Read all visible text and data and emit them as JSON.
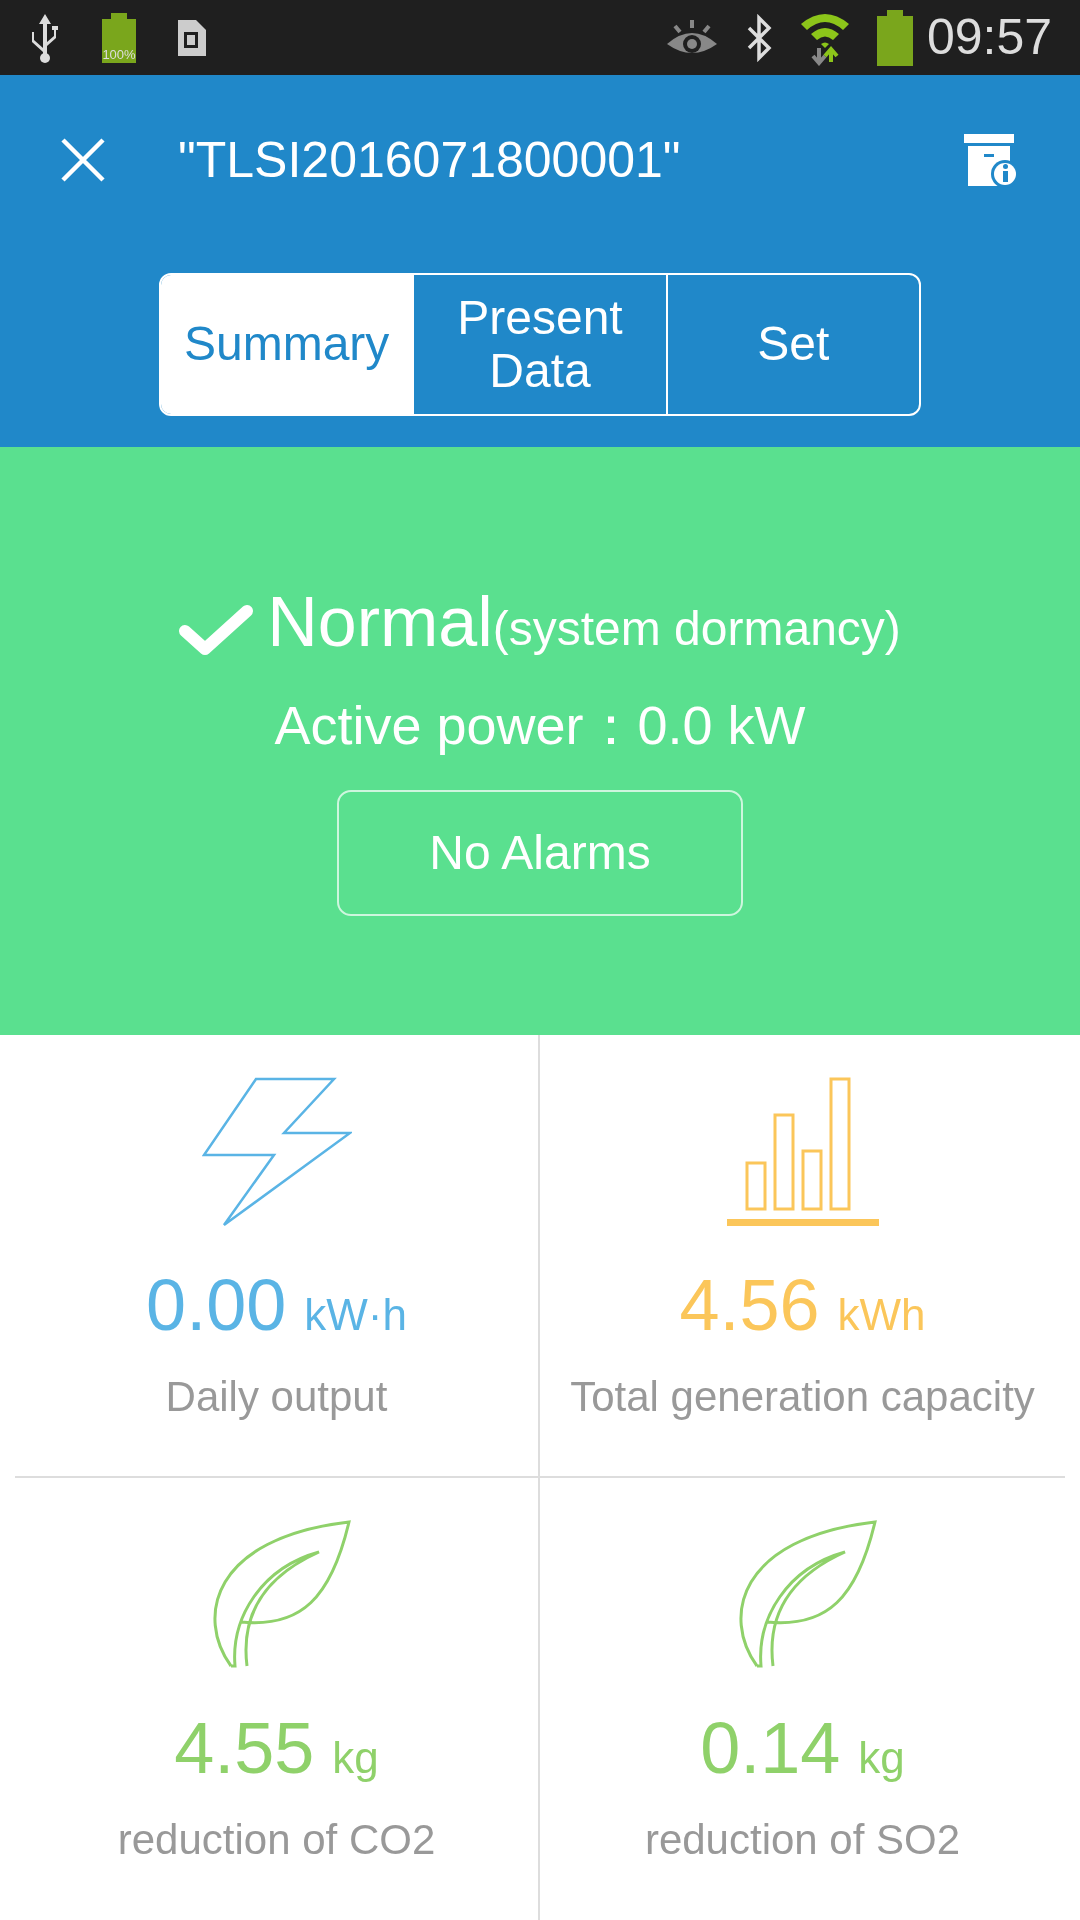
{
  "status_bar": {
    "battery_label": "100%",
    "time": "09:57"
  },
  "header": {
    "title": "\"TLSI2016071800001\""
  },
  "tabs": [
    {
      "label": "Summary",
      "selected": true
    },
    {
      "label": "Present Data",
      "selected": false
    },
    {
      "label": "Set",
      "selected": false
    }
  ],
  "status": {
    "state": "Normal",
    "detail": "(system dormancy)",
    "active_power": "Active power：0.0 kW",
    "alarms_button": "No Alarms"
  },
  "tiles": [
    {
      "kind": "bolt",
      "color": "#5ab4e5",
      "value": "0.00",
      "unit": "kW·h",
      "label": "Daily output"
    },
    {
      "kind": "bars",
      "color": "#fbc65a",
      "value": "4.56",
      "unit": "kWh",
      "label": "Total generation capacity"
    },
    {
      "kind": "leaf",
      "color": "#8fd16a",
      "value": "4.55",
      "unit": "kg",
      "label": "reduction of CO2"
    },
    {
      "kind": "leaf",
      "color": "#8fd16a",
      "value": "0.14",
      "unit": "kg",
      "label": "reduction of SO2"
    }
  ]
}
